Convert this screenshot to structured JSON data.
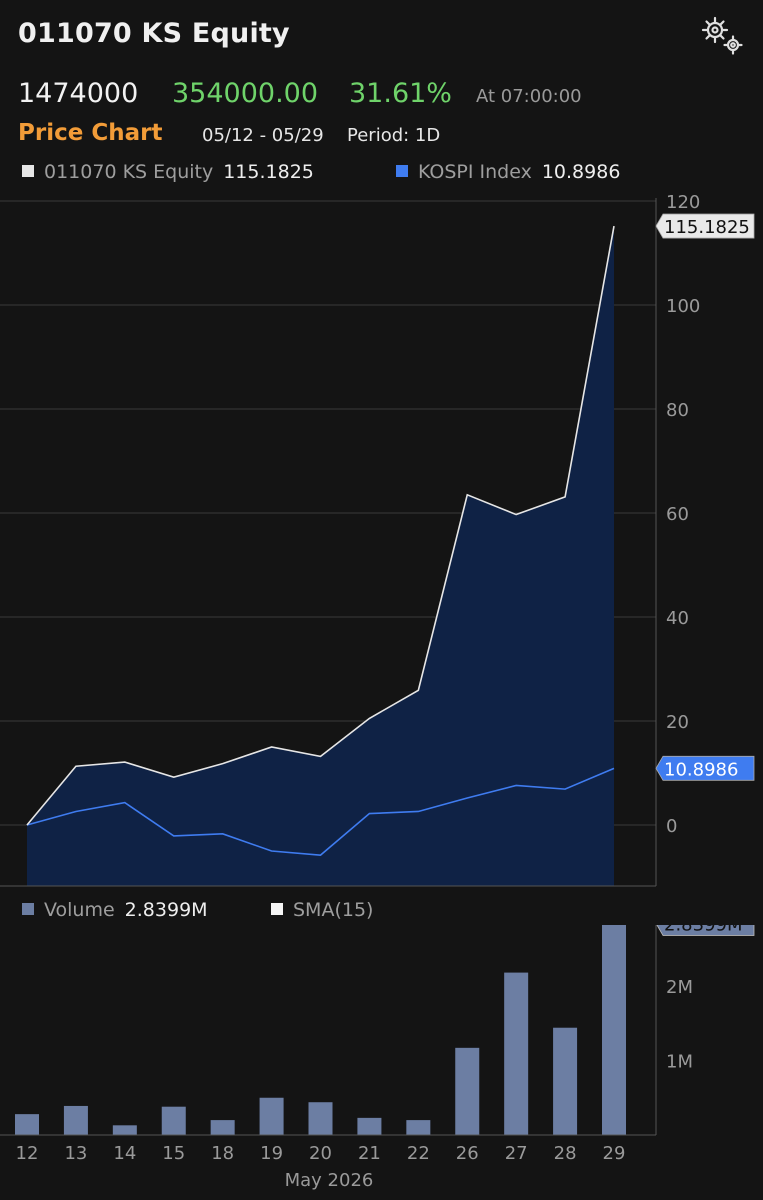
{
  "header": {
    "title": "011070 KS Equity",
    "price": "1474000",
    "change": "354000.00",
    "change_pct": "31.61%",
    "time_label": "At 07:00:00",
    "chart_title": "Price Chart",
    "date_range": "05/12 - 05/29",
    "period": "Period: 1D"
  },
  "icons": {
    "settings": "gear-icon"
  },
  "legend": {
    "equity_name": "011070 KS Equity",
    "equity_value": "115.1825",
    "index_name": "KOSPI Index",
    "index_value": "10.8986",
    "volume_name": "Volume",
    "volume_value": "2.8399M",
    "sma_name": "SMA(15)"
  },
  "colors": {
    "equity_line": "#e6e6e6",
    "equity_fill": "#0f2245",
    "index_line": "#3f7cf0",
    "volume_bar": "#6c7ea3",
    "up": "#6fd36a",
    "accent": "#f29c38"
  },
  "chart_data": [
    {
      "type": "area",
      "title": "Price Chart",
      "categories": [
        "12",
        "13",
        "14",
        "15",
        "18",
        "19",
        "20",
        "21",
        "22",
        "26",
        "27",
        "28",
        "29"
      ],
      "xlabel": "May 2026",
      "ylim": [
        -12,
        120
      ],
      "yticks": [
        0,
        20,
        40,
        60,
        80,
        100,
        120
      ],
      "series": [
        {
          "name": "011070 KS Equity",
          "values": [
            0,
            11.3,
            12.1,
            9.2,
            11.8,
            15.0,
            13.2,
            20.5,
            25.9,
            63.5,
            59.7,
            63.1,
            115.1825
          ],
          "last_label": "115.1825"
        },
        {
          "name": "KOSPI Index",
          "values": [
            0,
            2.6,
            4.3,
            -2.1,
            -1.7,
            -5.0,
            -5.8,
            2.2,
            2.6,
            5.2,
            7.6,
            6.9,
            10.8986
          ],
          "last_label": "10.8986"
        }
      ],
      "grid": true
    },
    {
      "type": "bar",
      "title": "Volume",
      "categories": [
        "12",
        "13",
        "14",
        "15",
        "18",
        "19",
        "20",
        "21",
        "22",
        "26",
        "27",
        "28",
        "29"
      ],
      "xlabel": "May 2026",
      "ylim": [
        0,
        2.9
      ],
      "yticks": [
        1,
        2
      ],
      "ytick_labels": [
        "1M",
        "2M"
      ],
      "series": [
        {
          "name": "Volume",
          "values": [
            0.28,
            0.39,
            0.13,
            0.38,
            0.2,
            0.5,
            0.44,
            0.23,
            0.2,
            1.17,
            2.18,
            1.44,
            2.8399
          ],
          "last_label": "2.8399M"
        }
      ]
    }
  ]
}
